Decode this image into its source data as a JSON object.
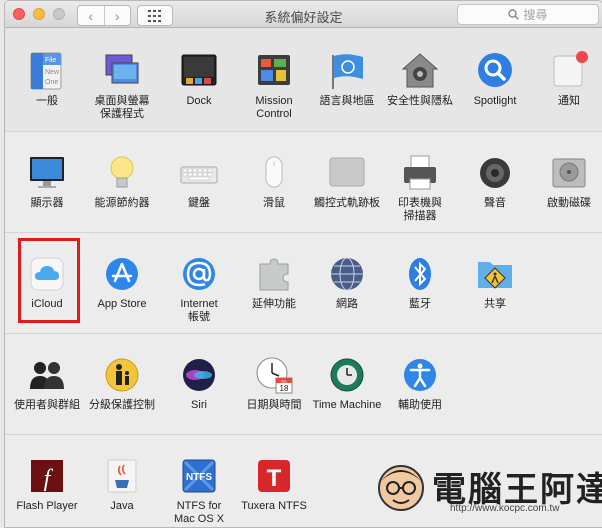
{
  "window": {
    "title": "系統偏好設定"
  },
  "toolbar": {
    "back": "‹",
    "forward": "›",
    "search_placeholder": "搜尋"
  },
  "rows": [
    [
      {
        "label": "一般"
      },
      {
        "label": "桌面與螢幕\n保護程式"
      },
      {
        "label": "Dock"
      },
      {
        "label": "Mission\nControl"
      },
      {
        "label": "語言與地區"
      },
      {
        "label": "安全性與隱私"
      },
      {
        "label": "Spotlight"
      },
      {
        "label": "通知"
      }
    ],
    [
      {
        "label": "顯示器"
      },
      {
        "label": "能源節約器"
      },
      {
        "label": "鍵盤"
      },
      {
        "label": "滑鼠"
      },
      {
        "label": "觸控式軌跡板"
      },
      {
        "label": "印表機與\n掃描器"
      },
      {
        "label": "聲音"
      },
      {
        "label": "啟動磁碟"
      }
    ],
    [
      {
        "label": "iCloud"
      },
      {
        "label": "App Store"
      },
      {
        "label": "Internet\n帳號"
      },
      {
        "label": "延伸功能"
      },
      {
        "label": "網路"
      },
      {
        "label": "藍牙"
      },
      {
        "label": "共享"
      }
    ],
    [
      {
        "label": "使用者與群組"
      },
      {
        "label": "分級保護控制"
      },
      {
        "label": "Siri"
      },
      {
        "label": "日期與時間"
      },
      {
        "label": "Time Machine"
      },
      {
        "label": "輔助使用"
      }
    ],
    [
      {
        "label": "Flash Player"
      },
      {
        "label": "Java"
      },
      {
        "label": "NTFS for\nMac OS X"
      },
      {
        "label": "Tuxera NTFS"
      }
    ]
  ],
  "icon_text": {
    "file": "File",
    "new": "New",
    "one": "One",
    "calendar_month": "JUL",
    "calendar_day": "18",
    "flash": "f",
    "ntfs": "NTFS",
    "tuxera": "T"
  },
  "watermark": {
    "brand": "電腦王阿達",
    "url": "http://www.kocpc.com.tw"
  },
  "colors": {
    "highlight": "#e01b1b",
    "close": "#fc605c",
    "minimize": "#fdbc40"
  }
}
